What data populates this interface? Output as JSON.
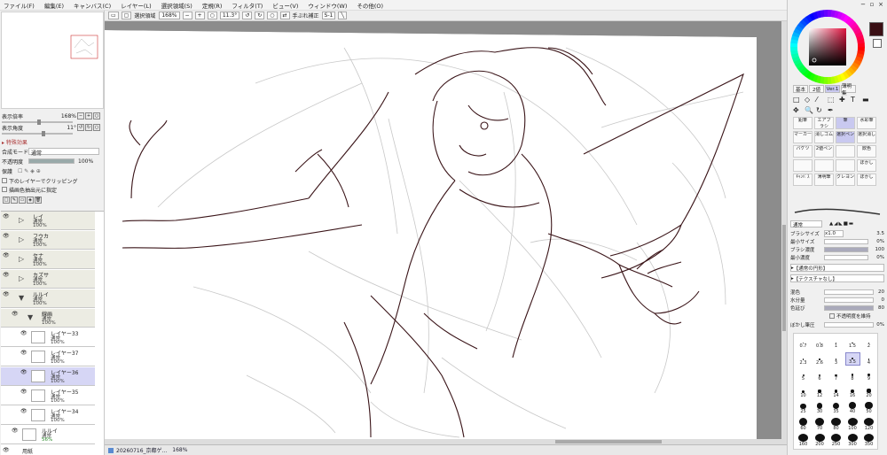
{
  "menu": [
    "ファイル(F)",
    "編集(E)",
    "キャンバス(C)",
    "レイヤー(L)",
    "選択領域(S)",
    "定規(R)",
    "フィルタ(T)",
    "ビュー(V)",
    "ウィンドウ(W)",
    "その他(O)"
  ],
  "canvas_toolbar": {
    "selection_label": "選択領域",
    "zoom_value": "168%",
    "angle_value": "11.3°",
    "stabilizer_label": "手ぶれ補正",
    "stabilizer_value": "S-1"
  },
  "navigator": {
    "zoom_label": "表示倍率",
    "zoom_value": "168%",
    "angle_label": "表示角度",
    "angle_value": "11°"
  },
  "layer_props": {
    "special_effects": "特殊効果",
    "blend_label": "合成モード",
    "blend_value": "通常",
    "opacity_label": "不透明度",
    "opacity_value": "100%",
    "protect_label": "保護",
    "clip_label": "下のレイヤーでクリッピング",
    "source_label": "描画色抽出元に指定"
  },
  "layers": [
    {
      "name": "レイ",
      "mode": "通常",
      "opacity": "100%",
      "type": "folder"
    },
    {
      "name": "フウカ",
      "mode": "通常",
      "opacity": "100%",
      "type": "folder"
    },
    {
      "name": "セナ",
      "mode": "通常",
      "opacity": "100%",
      "type": "folder"
    },
    {
      "name": "カズサ",
      "mode": "通常",
      "opacity": "100%",
      "type": "folder"
    },
    {
      "name": "ルルイ",
      "mode": "通常",
      "opacity": "100%",
      "type": "folder-open"
    },
    {
      "name": "線画",
      "mode": "通常",
      "opacity": "100%",
      "type": "folder-open"
    },
    {
      "name": "レイヤー33",
      "mode": "通常",
      "opacity": "100%",
      "type": "layer"
    },
    {
      "name": "レイヤー37",
      "mode": "通常",
      "opacity": "100%",
      "type": "layer"
    },
    {
      "name": "レイヤー36",
      "mode": "通常",
      "opacity": "100%",
      "type": "layer-selected"
    },
    {
      "name": "レイヤー35",
      "mode": "通常",
      "opacity": "100%",
      "type": "layer"
    },
    {
      "name": "レイヤー34",
      "mode": "通常",
      "opacity": "100%",
      "type": "layer"
    },
    {
      "name": "ルルイ",
      "mode": "通常",
      "opacity": "56%",
      "type": "layer"
    },
    {
      "name": "用紙",
      "mode": "",
      "opacity": "",
      "type": "paper"
    }
  ],
  "tab": {
    "title": "20260716_京都ゲ...",
    "zoom": "168%"
  },
  "right_panel": {
    "tabs": [
      "基本",
      "2値",
      "Ver.1",
      "薄明集"
    ],
    "tools": [
      [
        "鉛筆",
        "エアブラシ",
        "筆",
        "水彩筆"
      ],
      [
        "マーカー",
        "消しゴム",
        "選択ペン",
        "選択消し"
      ],
      [
        "バケツ",
        "2値ペン",
        "",
        "飲色"
      ],
      [
        "",
        "",
        "",
        "ぼかし"
      ],
      [
        "ｷｬﾝﾊﾞｽ",
        "薄明筆",
        "クレヨン",
        "ぼかし"
      ]
    ],
    "brush_mode": "通常",
    "brush_size_label": "ブラシサイズ",
    "brush_size_mult": "x1.0",
    "brush_size_value": "3.5",
    "min_size_label": "最小サイズ",
    "min_size_value": "0%",
    "density_label": "ブラシ濃度",
    "density_value": "100",
    "min_density_label": "最小濃度",
    "min_density_value": "0%",
    "shape_label": "【通常の円形】",
    "texture_label": "【テクスチャなし】",
    "blend_label": "混色",
    "blend_value": "20",
    "water_label": "水分量",
    "water_value": "0",
    "extend_label": "色延び",
    "extend_value": "80",
    "keep_opacity_label": "不透明度を維持",
    "blur_label": "ぼかし筆圧",
    "blur_value": "0%",
    "size_presets": [
      "0.7",
      "0.8",
      "1",
      "1.5",
      "2",
      "2.3",
      "2.6",
      "3",
      "3.5",
      "4",
      "5",
      "6",
      "7",
      "8",
      "9",
      "10",
      "12",
      "14",
      "16",
      "20",
      "25",
      "30",
      "35",
      "40",
      "50",
      "60",
      "70",
      "80",
      "100",
      "120",
      "160",
      "200",
      "250",
      "300",
      "350"
    ],
    "selected_size": "3.5",
    "main_color": "#3a0f14"
  }
}
